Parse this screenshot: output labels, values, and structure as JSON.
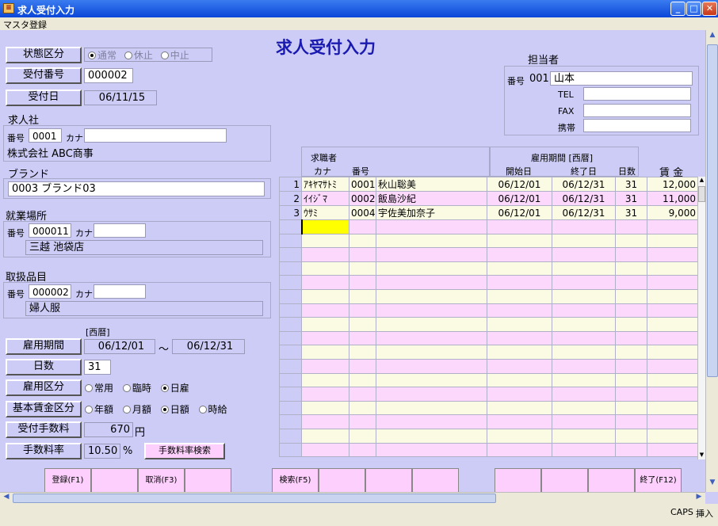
{
  "window": {
    "title": "求人受付入力",
    "min": "_",
    "max": "□",
    "close": "✕"
  },
  "menu": {
    "item": "マスタ登録"
  },
  "form_title": "求人受付入力",
  "state": {
    "label": "状態区分",
    "options": [
      "通常",
      "休止",
      "中止"
    ],
    "selected": 0
  },
  "receipt_no": {
    "label": "受付番号",
    "value": "000002"
  },
  "receipt_date": {
    "label": "受付日",
    "value": "06/11/15"
  },
  "company": {
    "section": "求人社",
    "no_label": "番号",
    "no": "0001",
    "kana_label": "カナ",
    "kana": "",
    "name": "株式会社 ABC商事"
  },
  "brand": {
    "section": "ブランド",
    "value": "0003 ブランド03"
  },
  "workplace": {
    "section": "就業場所",
    "no_label": "番号",
    "no": "000011",
    "kana_label": "カナ",
    "kana": "",
    "name": "三越 池袋店"
  },
  "goods": {
    "section": "取扱品目",
    "no_label": "番号",
    "no": "000002",
    "kana_label": "カナ",
    "kana": "",
    "name": "婦人服"
  },
  "period": {
    "era": "[西暦]",
    "label": "雇用期間",
    "from": "06/12/01",
    "sep": "～",
    "to": "06/12/31"
  },
  "days": {
    "label": "日数",
    "value": "31"
  },
  "employ_type": {
    "label": "雇用区分",
    "options": [
      "常用",
      "臨時",
      "日雇"
    ],
    "selected": 2
  },
  "wage_type": {
    "label": "基本賃金区分",
    "options": [
      "年額",
      "月額",
      "日額",
      "時給"
    ],
    "selected": 2
  },
  "fee": {
    "label": "受付手数料",
    "value": "670",
    "unit": "円"
  },
  "fee_rate": {
    "label": "手数料率",
    "value": "10.50",
    "unit": "%",
    "search": "手数料率検索"
  },
  "staff": {
    "title": "担当者",
    "no_label": "番号",
    "no": "001",
    "name": "山本",
    "tel_label": "TEL",
    "tel": "",
    "fax_label": "FAX",
    "fax": "",
    "mobile_label": "携帯",
    "mobile": ""
  },
  "grid": {
    "h_seeker": "求職者",
    "h_kana": "カナ",
    "h_no": "番号",
    "h_period": "雇用期間 [西暦]",
    "h_start": "開始日",
    "h_end": "終了日",
    "h_days": "日数",
    "h_wage": "賃 金",
    "rows": [
      {
        "n": "1",
        "kana": "ｱｷﾔﾏｻﾄﾐ",
        "no": "0001",
        "name": "秋山聡美",
        "start": "06/12/01",
        "end": "06/12/31",
        "days": "31",
        "wage": "12,000"
      },
      {
        "n": "2",
        "kana": "ｲｲｼﾞﾏ",
        "no": "0002",
        "name": "飯島沙紀",
        "start": "06/12/01",
        "end": "06/12/31",
        "days": "31",
        "wage": "11,000"
      },
      {
        "n": "3",
        "kana": "ｳｻﾐ",
        "no": "0004",
        "name": "宇佐美加奈子",
        "start": "06/12/01",
        "end": "06/12/31",
        "days": "31",
        "wage": "9,000"
      }
    ]
  },
  "fkeys": {
    "f1": "登録(F1)",
    "f3": "取消(F3)",
    "f5": "検索(F5)",
    "f12": "終了(F12)"
  },
  "status": {
    "caps": "CAPS",
    "ins": "挿入"
  }
}
